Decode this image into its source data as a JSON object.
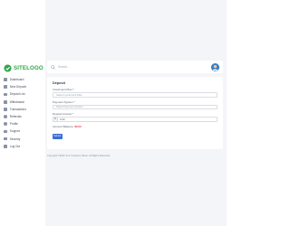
{
  "brand": {
    "logo_text": "SITELOGO",
    "color": "#2ea64a"
  },
  "sidebar": {
    "items": [
      {
        "label": "Dashboard",
        "icon": "dashboard-icon"
      },
      {
        "label": "New Deposit",
        "icon": "deposit-icon"
      },
      {
        "label": "Deposit List",
        "icon": "list-icon"
      },
      {
        "label": "Withdrawal",
        "icon": "withdraw-icon"
      },
      {
        "label": "Transactions",
        "icon": "transactions-icon"
      },
      {
        "label": "Referrals",
        "icon": "referrals-icon"
      },
      {
        "label": "Profile",
        "icon": "profile-icon"
      },
      {
        "label": "Support",
        "icon": "support-icon"
      },
      {
        "label": "Security",
        "icon": "security-icon"
      },
      {
        "label": "Log Out",
        "icon": "logout-icon"
      }
    ]
  },
  "topbar": {
    "search_placeholder": "Search..."
  },
  "deposit": {
    "title": "Deposit",
    "investment_plan": {
      "label": "Investment Plan *",
      "placeholder": "Select Investment Plan"
    },
    "payment_system": {
      "label": "Payment System *",
      "placeholder": "Select Payment System"
    },
    "amount": {
      "label": "Deposit Amount *",
      "prefix": "$",
      "value": "0.00"
    },
    "balance": {
      "label": "Account Balance:",
      "value": "$0.00"
    },
    "submit_label": "Submit"
  },
  "footer": {
    "text": "Copyright ©2022 Your Company Name. All Rights Reserved."
  },
  "colors": {
    "accent": "#3a6fd6",
    "balance": "#e53935",
    "background": "#f3f5f8"
  }
}
